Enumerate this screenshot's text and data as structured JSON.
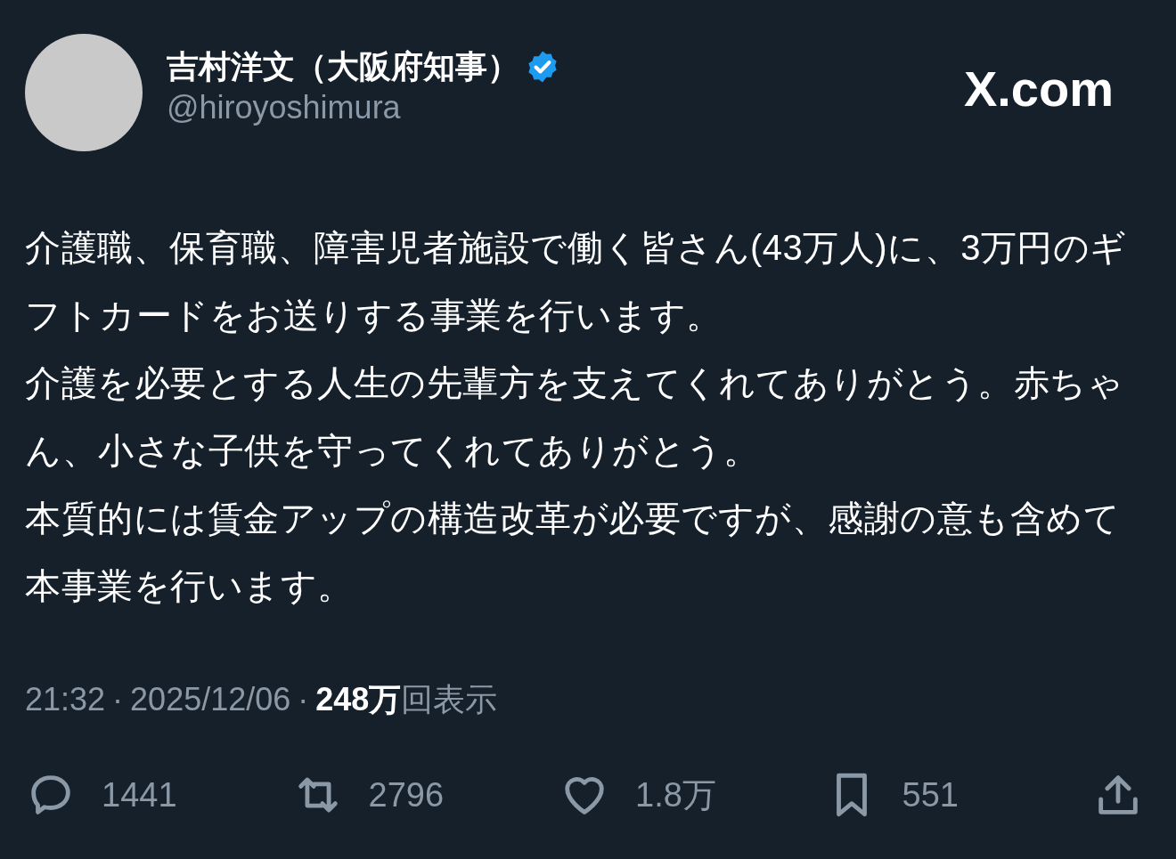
{
  "author": {
    "name": "吉村洋文（大阪府知事）",
    "verified": true,
    "handle": "@hiroyoshimura"
  },
  "site": "X.com",
  "body": [
    "介護職、保育職、障害児者施設で働く皆さん(43万人)に、3万円のギフトカードをお送りする事業を行います。",
    "介護を必要とする人生の先輩方を支えてくれてありがとう。赤ちゃん、小さな子供を守ってくれてありがとう。",
    "本質的には賃金アップの構造改革が必要ですが、感謝の意も含めて本事業を行います。"
  ],
  "meta": {
    "time": "21:32",
    "separator": "·",
    "date": "2025/12/06",
    "views": "248万",
    "views_label": "回表示"
  },
  "actions": [
    {
      "kind": "reply",
      "count": "1441"
    },
    {
      "kind": "repost",
      "count": "2796"
    },
    {
      "kind": "like",
      "count": "1.8万"
    },
    {
      "kind": "bookmark",
      "count": "551"
    },
    {
      "kind": "share"
    }
  ]
}
